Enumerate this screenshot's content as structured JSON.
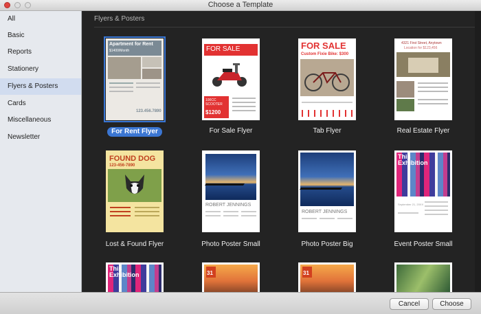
{
  "window": {
    "title": "Choose a Template"
  },
  "sidebar": {
    "items": [
      {
        "label": "All"
      },
      {
        "label": "Basic"
      },
      {
        "label": "Reports"
      },
      {
        "label": "Stationery"
      },
      {
        "label": "Flyers & Posters"
      },
      {
        "label": "Cards"
      },
      {
        "label": "Miscellaneous"
      },
      {
        "label": "Newsletter"
      }
    ],
    "selected": "Flyers & Posters"
  },
  "content": {
    "section_title": "Flyers & Posters",
    "templates": [
      {
        "label": "For Rent Flyer",
        "selected": true
      },
      {
        "label": "For Sale Flyer"
      },
      {
        "label": "Tab Flyer"
      },
      {
        "label": "Real Estate Flyer"
      },
      {
        "label": "Lost & Found Flyer"
      },
      {
        "label": "Photo Poster Small"
      },
      {
        "label": "Photo Poster Big"
      },
      {
        "label": "Event Poster Small"
      }
    ],
    "thumbs": {
      "rent_title": "Apartment for Rent",
      "rent_sub": "$1400/Month",
      "rent_phone": "123.456.7890",
      "sale_title": "FOR SALE",
      "sale_box": "100CC SCOOTER",
      "sale_price": "$1200",
      "tab_title": "FOR SALE",
      "tab_sub": "Custom Fixie Bike: $300",
      "estate_addr": "4321 First Street, Anytown",
      "estate_sub": "Location for $123,456",
      "dog_title": "FOUND DOG",
      "dog_phone": "123-456-7890",
      "poster_name_small": "ROBERT JENNINGS",
      "poster_name_big": "ROBERT JENNINGS",
      "event_title": "This Exhibition",
      "event_date": "September 21, 20XX",
      "event_title_2": "This Exhibition",
      "calendar_day": "31",
      "calendar_day_2": "31"
    }
  },
  "buttons": {
    "cancel": "Cancel",
    "choose": "Choose"
  }
}
